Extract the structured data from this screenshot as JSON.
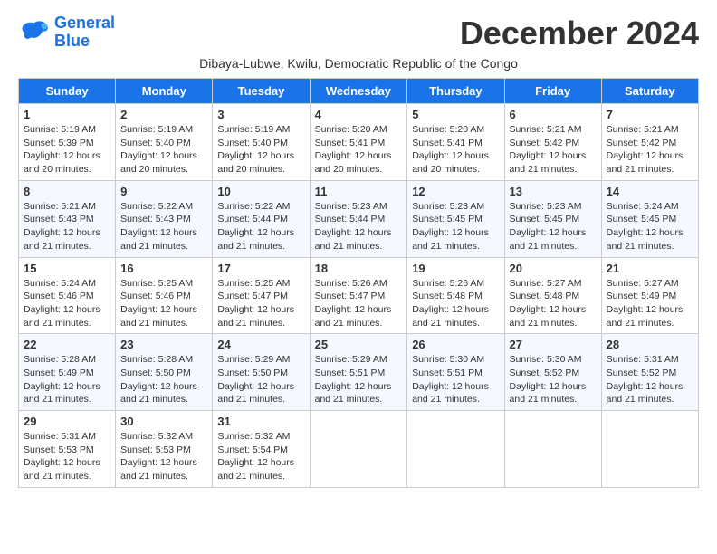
{
  "logo": {
    "line1": "General",
    "line2": "Blue"
  },
  "title": "December 2024",
  "subtitle": "Dibaya-Lubwe, Kwilu, Democratic Republic of the Congo",
  "headers": [
    "Sunday",
    "Monday",
    "Tuesday",
    "Wednesday",
    "Thursday",
    "Friday",
    "Saturday"
  ],
  "weeks": [
    [
      {
        "day": "1",
        "sunrise": "5:19 AM",
        "sunset": "5:39 PM",
        "daylight": "12 hours and 20 minutes."
      },
      {
        "day": "2",
        "sunrise": "5:19 AM",
        "sunset": "5:40 PM",
        "daylight": "12 hours and 20 minutes."
      },
      {
        "day": "3",
        "sunrise": "5:19 AM",
        "sunset": "5:40 PM",
        "daylight": "12 hours and 20 minutes."
      },
      {
        "day": "4",
        "sunrise": "5:20 AM",
        "sunset": "5:41 PM",
        "daylight": "12 hours and 20 minutes."
      },
      {
        "day": "5",
        "sunrise": "5:20 AM",
        "sunset": "5:41 PM",
        "daylight": "12 hours and 20 minutes."
      },
      {
        "day": "6",
        "sunrise": "5:21 AM",
        "sunset": "5:42 PM",
        "daylight": "12 hours and 21 minutes."
      },
      {
        "day": "7",
        "sunrise": "5:21 AM",
        "sunset": "5:42 PM",
        "daylight": "12 hours and 21 minutes."
      }
    ],
    [
      {
        "day": "8",
        "sunrise": "5:21 AM",
        "sunset": "5:43 PM",
        "daylight": "12 hours and 21 minutes."
      },
      {
        "day": "9",
        "sunrise": "5:22 AM",
        "sunset": "5:43 PM",
        "daylight": "12 hours and 21 minutes."
      },
      {
        "day": "10",
        "sunrise": "5:22 AM",
        "sunset": "5:44 PM",
        "daylight": "12 hours and 21 minutes."
      },
      {
        "day": "11",
        "sunrise": "5:23 AM",
        "sunset": "5:44 PM",
        "daylight": "12 hours and 21 minutes."
      },
      {
        "day": "12",
        "sunrise": "5:23 AM",
        "sunset": "5:45 PM",
        "daylight": "12 hours and 21 minutes."
      },
      {
        "day": "13",
        "sunrise": "5:23 AM",
        "sunset": "5:45 PM",
        "daylight": "12 hours and 21 minutes."
      },
      {
        "day": "14",
        "sunrise": "5:24 AM",
        "sunset": "5:45 PM",
        "daylight": "12 hours and 21 minutes."
      }
    ],
    [
      {
        "day": "15",
        "sunrise": "5:24 AM",
        "sunset": "5:46 PM",
        "daylight": "12 hours and 21 minutes."
      },
      {
        "day": "16",
        "sunrise": "5:25 AM",
        "sunset": "5:46 PM",
        "daylight": "12 hours and 21 minutes."
      },
      {
        "day": "17",
        "sunrise": "5:25 AM",
        "sunset": "5:47 PM",
        "daylight": "12 hours and 21 minutes."
      },
      {
        "day": "18",
        "sunrise": "5:26 AM",
        "sunset": "5:47 PM",
        "daylight": "12 hours and 21 minutes."
      },
      {
        "day": "19",
        "sunrise": "5:26 AM",
        "sunset": "5:48 PM",
        "daylight": "12 hours and 21 minutes."
      },
      {
        "day": "20",
        "sunrise": "5:27 AM",
        "sunset": "5:48 PM",
        "daylight": "12 hours and 21 minutes."
      },
      {
        "day": "21",
        "sunrise": "5:27 AM",
        "sunset": "5:49 PM",
        "daylight": "12 hours and 21 minutes."
      }
    ],
    [
      {
        "day": "22",
        "sunrise": "5:28 AM",
        "sunset": "5:49 PM",
        "daylight": "12 hours and 21 minutes."
      },
      {
        "day": "23",
        "sunrise": "5:28 AM",
        "sunset": "5:50 PM",
        "daylight": "12 hours and 21 minutes."
      },
      {
        "day": "24",
        "sunrise": "5:29 AM",
        "sunset": "5:50 PM",
        "daylight": "12 hours and 21 minutes."
      },
      {
        "day": "25",
        "sunrise": "5:29 AM",
        "sunset": "5:51 PM",
        "daylight": "12 hours and 21 minutes."
      },
      {
        "day": "26",
        "sunrise": "5:30 AM",
        "sunset": "5:51 PM",
        "daylight": "12 hours and 21 minutes."
      },
      {
        "day": "27",
        "sunrise": "5:30 AM",
        "sunset": "5:52 PM",
        "daylight": "12 hours and 21 minutes."
      },
      {
        "day": "28",
        "sunrise": "5:31 AM",
        "sunset": "5:52 PM",
        "daylight": "12 hours and 21 minutes."
      }
    ],
    [
      {
        "day": "29",
        "sunrise": "5:31 AM",
        "sunset": "5:53 PM",
        "daylight": "12 hours and 21 minutes."
      },
      {
        "day": "30",
        "sunrise": "5:32 AM",
        "sunset": "5:53 PM",
        "daylight": "12 hours and 21 minutes."
      },
      {
        "day": "31",
        "sunrise": "5:32 AM",
        "sunset": "5:54 PM",
        "daylight": "12 hours and 21 minutes."
      },
      null,
      null,
      null,
      null
    ]
  ]
}
